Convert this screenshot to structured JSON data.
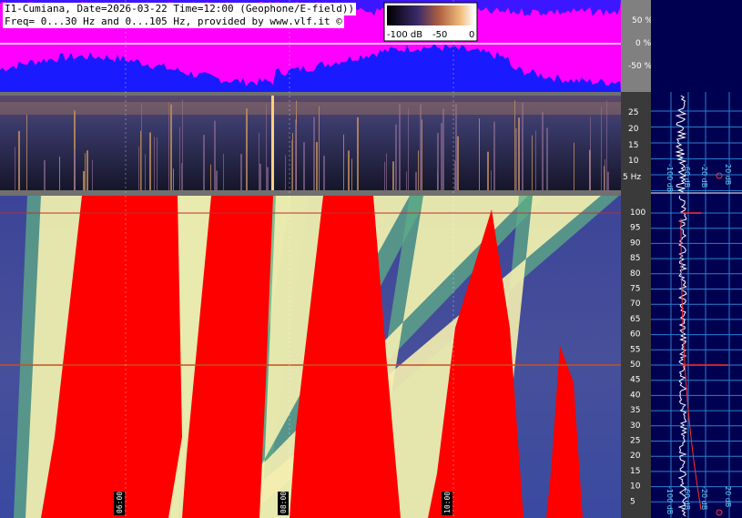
{
  "header": {
    "line1": "I1-Cumiana, Date=2026-03-22 Time=12:00 (Geophone/E-field))",
    "line2": "Freq= 0...30 Hz and 0...105 Hz, provided by www.vlf.it ©"
  },
  "colorbar": {
    "min_label": "-100 dB",
    "mid_label": "-50",
    "max_label": "0"
  },
  "amplitude_panel": {
    "ticks": [
      "50 %",
      "0 %",
      "-50 %"
    ],
    "colors": {
      "background": "#ff00ff",
      "signal": "#1a1aff",
      "baseline": "#ffffff"
    }
  },
  "low_spectrogram": {
    "ticks": [
      "25",
      "20",
      "15",
      "10",
      "5 Hz"
    ]
  },
  "high_spectrogram": {
    "ticks": [
      "100",
      "95",
      "90",
      "85",
      "80",
      "75",
      "70",
      "65",
      "60",
      "55",
      "50",
      "45",
      "40",
      "35",
      "30",
      "25",
      "20",
      "15",
      "10",
      "5"
    ],
    "colors": {
      "red": "#ff0000",
      "cream": "#f4eeb0",
      "green": "#5fae85",
      "blue": "#3a3f9a"
    }
  },
  "time_labels": [
    "06:00",
    "08:00",
    "10:00"
  ],
  "side_panel": {
    "upper_labels": [
      "-100 dB",
      "-60 dB",
      "-20 dB",
      "20 dB"
    ],
    "lower_labels": [
      "-100 dB",
      "-60 dB",
      "-20 dB",
      "20 dB"
    ],
    "colors": {
      "background": "#000050",
      "grid": "#2a7fd0",
      "trace": "#ffffff",
      "fit": "#ff2020"
    }
  }
}
